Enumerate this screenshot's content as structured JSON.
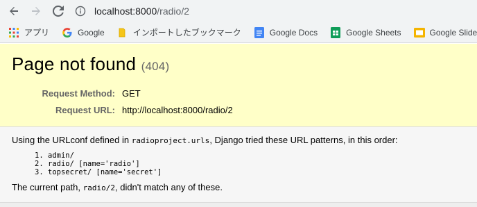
{
  "browser": {
    "url_host": "localhost:8000",
    "url_path": "/radio/2",
    "bookmarks": [
      {
        "label": "アプリ",
        "icon": "apps-grid-icon"
      },
      {
        "label": "Google",
        "icon": "google-g-icon"
      },
      {
        "label": "インポートしたブックマーク",
        "icon": "folder-icon"
      },
      {
        "label": "Google Docs",
        "icon": "google-docs-icon"
      },
      {
        "label": "Google Sheets",
        "icon": "google-sheets-icon"
      },
      {
        "label": "Google Slides",
        "icon": "google-slides-icon"
      }
    ]
  },
  "page": {
    "title": "Page not found",
    "status_code": "(404)",
    "request_method_label": "Request Method:",
    "request_method": "GET",
    "request_url_label": "Request URL:",
    "request_url": "http://localhost:8000/radio/2",
    "urlconf_prefix": "Using the URLconf defined in ",
    "urlconf_module": "radioproject.urls",
    "urlconf_suffix": ", Django tried these URL patterns, in this order:",
    "patterns": [
      "admin/",
      "radio/ [name='radio']",
      "topsecret/ [name='secret']"
    ],
    "current_path_prefix": "The current path, ",
    "current_path": "radio/2",
    "current_path_suffix": ", didn't match any of these."
  },
  "colors": {
    "summary_bg": "#ffffc8",
    "info_bg": "#f6f6f6"
  }
}
